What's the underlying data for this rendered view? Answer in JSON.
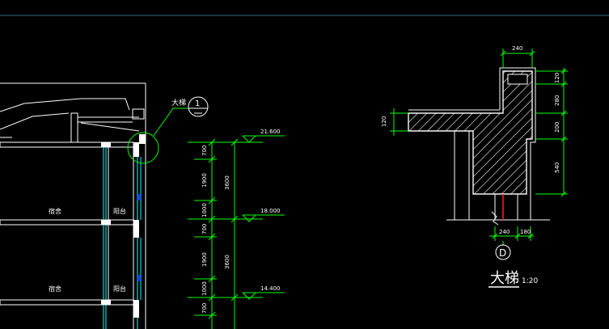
{
  "colors": {
    "background": "#000000",
    "white": "#ffffff",
    "green": "#00ff00",
    "cyan": "#00ffff",
    "blue": "#1a3cff",
    "red": "#ff2020",
    "topline": "#2e6e7e"
  },
  "section": {
    "callout_label": "大梯",
    "callout_number": "1",
    "room_labels": [
      "宿舍",
      "阳台",
      "宿舍",
      "阳台"
    ]
  },
  "dimensions": {
    "vertical_segments": [
      "700",
      "1900",
      "1000",
      "700",
      "1900",
      "1000",
      "700"
    ],
    "vertical_totals": [
      "3600",
      "3600"
    ]
  },
  "levels": [
    "21.600",
    "18.000",
    "14.400"
  ],
  "detail": {
    "top_width": "240",
    "slab_thickness": "120",
    "right_dims": [
      "120",
      "280",
      "200",
      "540"
    ],
    "bottom_dims": [
      "240",
      "180"
    ],
    "axis_label": "D",
    "title": "大梯",
    "scale": "1:20"
  }
}
